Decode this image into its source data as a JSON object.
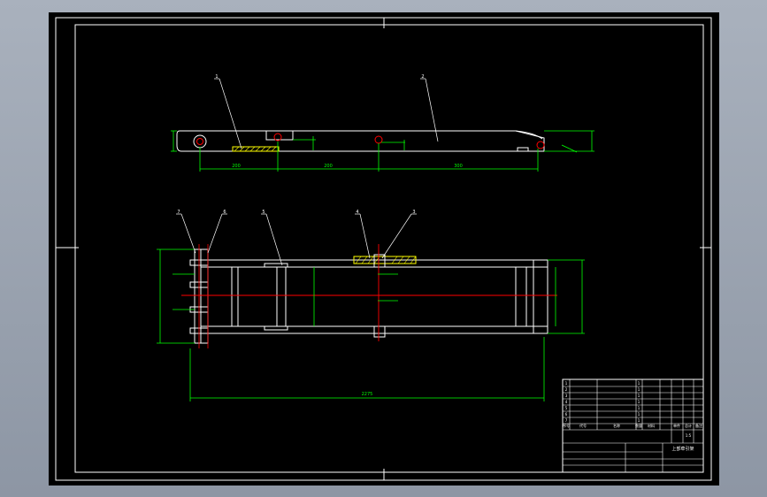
{
  "colors": {
    "background": "#000000",
    "outline": "#ffffff",
    "dimension": "#00ff00",
    "centerline": "#ff0000",
    "hatch": "#ffff00"
  },
  "top_view": {
    "balloons": [
      "1",
      "2"
    ],
    "dims": [
      "200",
      "200",
      "300"
    ]
  },
  "front_view": {
    "balloons": [
      "7",
      "6",
      "5",
      "4",
      "3"
    ],
    "dims": [
      "2275"
    ]
  },
  "title_block": {
    "rows": [
      "1",
      "2",
      "3",
      "4",
      "5",
      "6",
      "7"
    ],
    "header": [
      "序号",
      "代号",
      "名称",
      "数量",
      "材料",
      "单件",
      "总计",
      "备注"
    ],
    "part_name": "上部牵引架",
    "scale": "1:5",
    "count_values": [
      "1",
      "1",
      "1",
      "1",
      "1",
      "1",
      "1"
    ]
  }
}
